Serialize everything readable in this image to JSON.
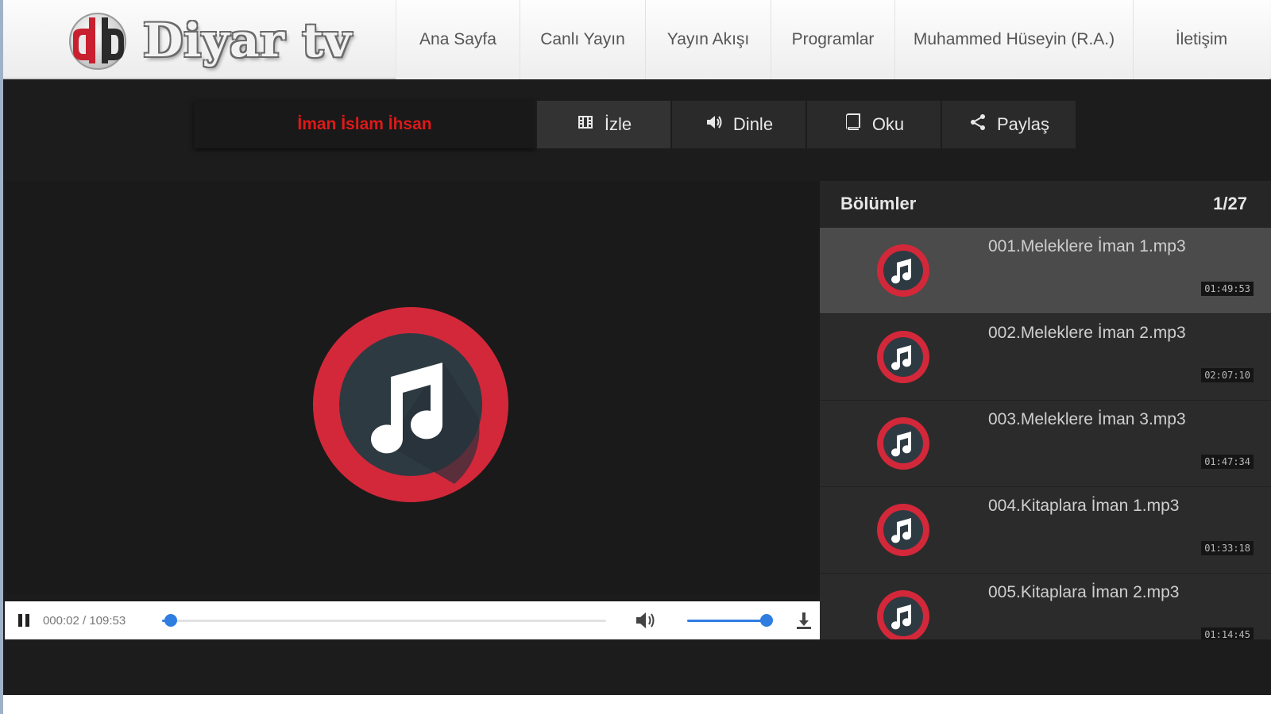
{
  "brand": {
    "name": "Diyar tv",
    "accent": "#d3283a"
  },
  "nav": [
    {
      "label": "Ana Sayfa"
    },
    {
      "label": "Canlı Yayın"
    },
    {
      "label": "Yayın Akışı"
    },
    {
      "label": "Programlar"
    },
    {
      "label": "Muhammed Hüseyin (R.A.)"
    },
    {
      "label": "İletişim"
    }
  ],
  "program": {
    "title": "İman İslam İhsan"
  },
  "tabs": [
    {
      "label": "İzle",
      "icon": "film-icon"
    },
    {
      "label": "Dinle",
      "icon": "speaker-icon"
    },
    {
      "label": "Oku",
      "icon": "book-icon"
    },
    {
      "label": "Paylaş",
      "icon": "share-icon"
    }
  ],
  "player": {
    "time": "000:02 / 109:53",
    "progress": 0.02,
    "volume": 0.95,
    "state": "playing"
  },
  "episodes": {
    "heading": "Bölümler",
    "counter": "1/27",
    "items": [
      {
        "title": "001.Meleklere İman 1.mp3",
        "duration": "01:49:53"
      },
      {
        "title": "002.Meleklere İman 2.mp3",
        "duration": "02:07:10"
      },
      {
        "title": "003.Meleklere İman 3.mp3",
        "duration": "01:47:34"
      },
      {
        "title": "004.Kitaplara İman 1.mp3",
        "duration": "01:33:18"
      },
      {
        "title": "005.Kitaplara İman 2.mp3",
        "duration": "01:14:45"
      }
    ]
  }
}
